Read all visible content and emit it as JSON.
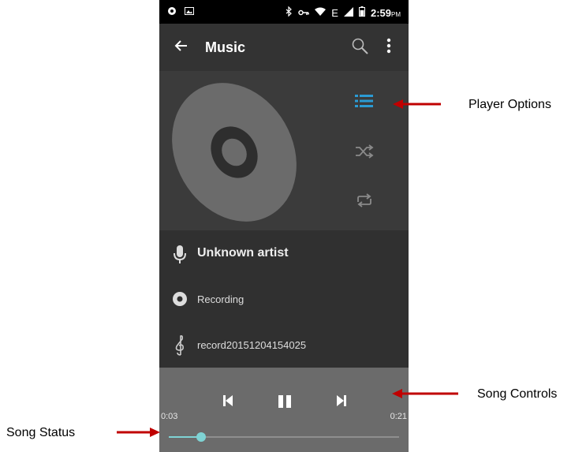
{
  "statusbar": {
    "time": "2:59",
    "ampm": "PM",
    "network": "E"
  },
  "appbar": {
    "title": "Music",
    "back_icon": "arrow-back-icon",
    "search_icon": "search-icon",
    "menu_icon": "more-vert-icon"
  },
  "player_options": {
    "icons": [
      "playlist-icon",
      "shuffle-icon",
      "repeat-icon"
    ],
    "active_color": "#2b9bd4"
  },
  "song_info": {
    "artist": "Unknown artist",
    "album": "Recording",
    "track": "record20151204154025"
  },
  "controls": {
    "current_time": "0:03",
    "total_time": "0:21",
    "progress_fraction": 0.14,
    "accent": "#7fd3d4"
  },
  "annotations": {
    "player_options": "Player Options",
    "song_controls": "Song Controls",
    "song_status": "Song Status",
    "arrow_color": "#c00000"
  }
}
